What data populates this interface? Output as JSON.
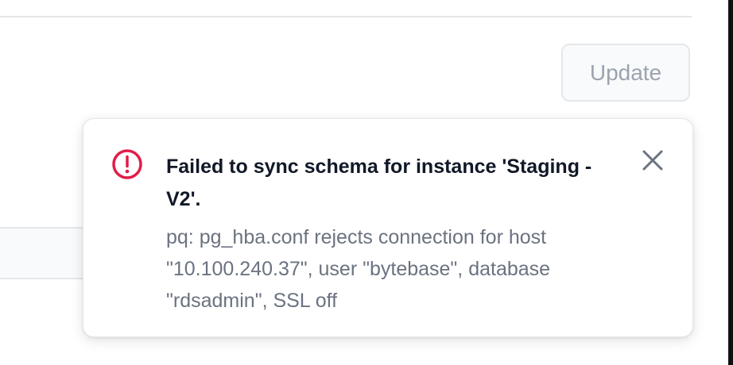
{
  "toolbar": {
    "update_label": "Update"
  },
  "notification": {
    "icon": "exclamation-circle-icon",
    "title": "Failed to sync schema for instance 'Staging - V2'.",
    "message": "pq: pg_hba.conf rejects connection for host \"10.100.240.37\", user \"bytebase\", database \"rdsadmin\", SSL off",
    "close_icon": "close-icon"
  },
  "colors": {
    "error": "#e11d48",
    "title_text": "#111827",
    "message_text": "#6b7280",
    "button_text_disabled": "#9ca3af",
    "border": "#e5e7eb"
  }
}
